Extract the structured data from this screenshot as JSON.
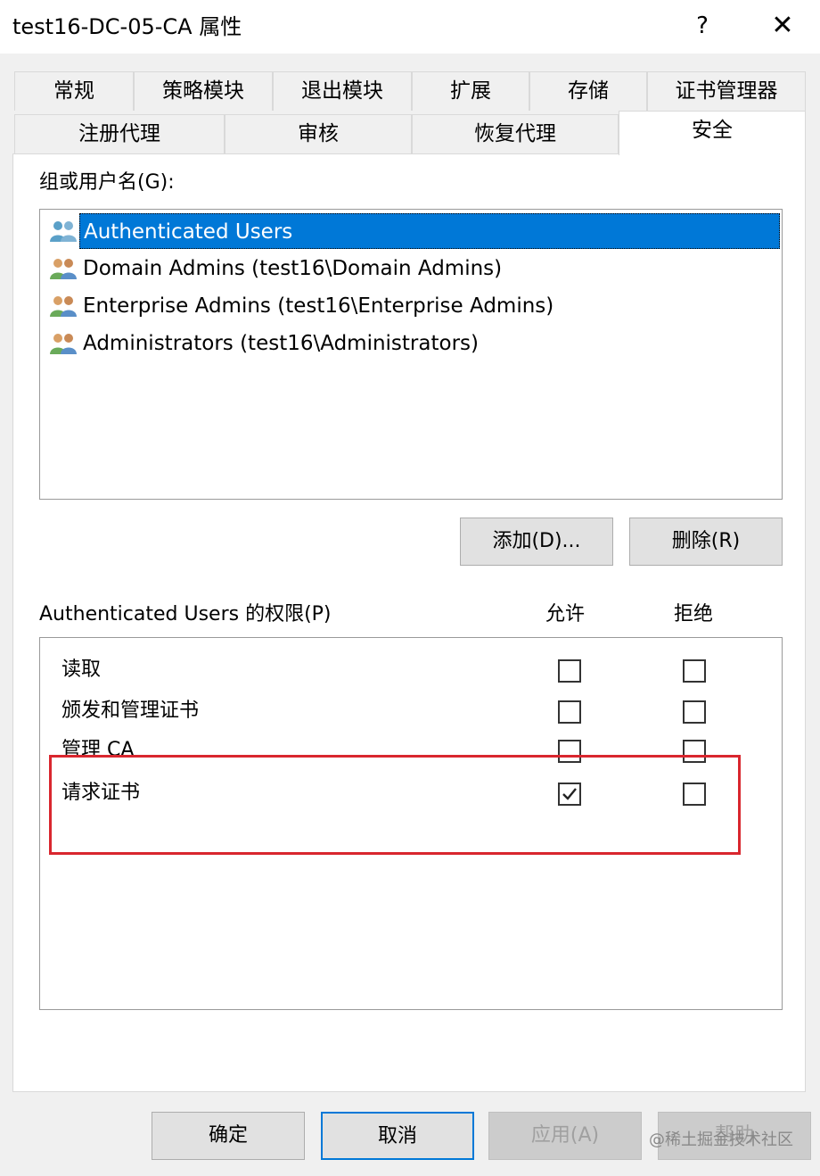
{
  "window": {
    "title": "test16-DC-05-CA 属性",
    "help_label": "?",
    "close_label": "✕"
  },
  "tabs_row1": [
    "常规",
    "策略模块",
    "退出模块",
    "扩展",
    "存储",
    "证书管理器"
  ],
  "tabs_row2": [
    "注册代理",
    "审核",
    "恢复代理",
    "安全"
  ],
  "active_tab": "安全",
  "groups": {
    "label": "组或用户名(G):",
    "items": [
      "Authenticated Users",
      "Domain Admins (test16\\Domain Admins)",
      "Enterprise Admins (test16\\Enterprise Admins)",
      "Administrators (test16\\Administrators)"
    ],
    "selected_index": 0,
    "add_label": "添加(D)...",
    "remove_label": "删除(R)"
  },
  "permissions": {
    "label": "Authenticated Users 的权限(P)",
    "allow_header": "允许",
    "deny_header": "拒绝",
    "rows": [
      {
        "name": "读取",
        "allow": false,
        "deny": false
      },
      {
        "name": "颁发和管理证书",
        "allow": false,
        "deny": false
      },
      {
        "name": "管理 CA",
        "allow": false,
        "deny": false
      },
      {
        "name": "请求证书",
        "allow": true,
        "deny": false
      }
    ]
  },
  "footer": {
    "ok_label": "确定",
    "cancel_label": "取消",
    "apply_label": "应用(A)",
    "help_label": "帮助"
  },
  "watermark": "@稀土掘金技术社区",
  "colors": {
    "selection": "#0078d7",
    "highlight_box": "#d9262e",
    "dialog_bg": "#f0f0f0"
  }
}
